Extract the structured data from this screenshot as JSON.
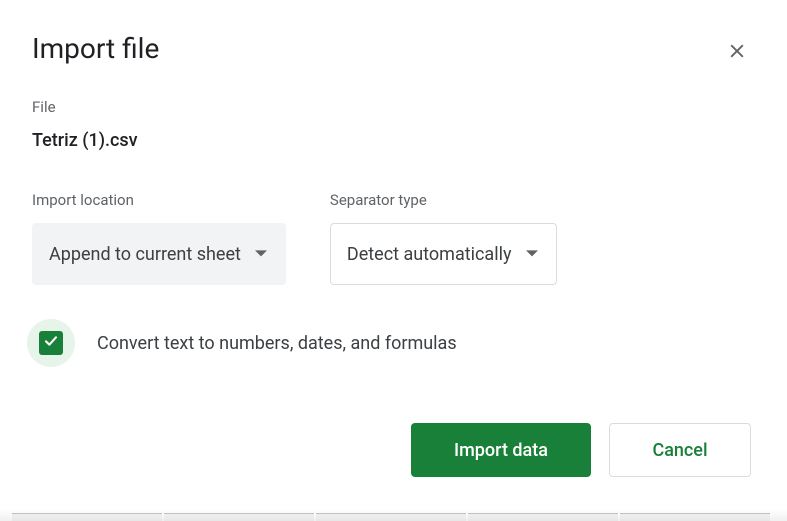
{
  "dialog": {
    "title": "Import file",
    "file_label": "File",
    "file_name": "Tetriz (1).csv",
    "import_location_label": "Import location",
    "import_location_value": "Append to current sheet",
    "separator_type_label": "Separator type",
    "separator_type_value": "Detect automatically",
    "convert_checkbox_label": "Convert text to numbers, dates, and formulas",
    "convert_checkbox_checked": true
  },
  "buttons": {
    "import": "Import data",
    "cancel": "Cancel"
  }
}
